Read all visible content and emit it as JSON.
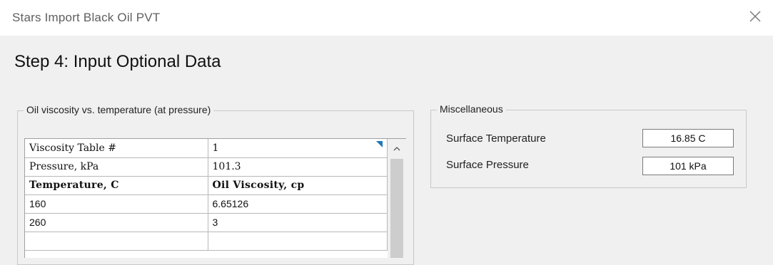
{
  "window": {
    "title": "Stars Import Black Oil PVT"
  },
  "step": {
    "title": "Step 4: Input Optional Data"
  },
  "viscosity_group": {
    "legend": "Oil viscosity vs. temperature (at pressure)",
    "rows": [
      {
        "label": "Viscosity Table #",
        "value": "1"
      },
      {
        "label": "Pressure, kPa",
        "value": "101.3"
      }
    ],
    "header": {
      "col1": "Temperature, C",
      "col2": "Oil Viscosity, cp"
    },
    "data": [
      {
        "temp": "160",
        "visc": "6.65126"
      },
      {
        "temp": "260",
        "visc": "3"
      }
    ]
  },
  "misc_group": {
    "legend": "Miscellaneous",
    "surface_temperature_label": "Surface Temperature",
    "surface_temperature_value": "16.85 C",
    "surface_pressure_label": "Surface Pressure",
    "surface_pressure_value": "101 kPa"
  },
  "colors": {
    "corner_marker": "#1e7ab8"
  },
  "icons": {
    "close": "close-icon",
    "scroll_up": "chevron-up-icon"
  }
}
